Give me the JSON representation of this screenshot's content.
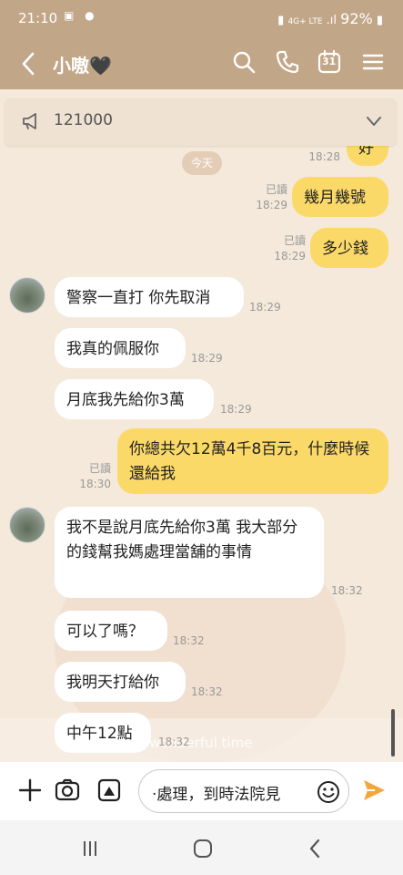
{
  "status_bar": {
    "time": "21:10",
    "network": "4G+ LTE",
    "battery": "92%"
  },
  "header": {
    "back_label": "<",
    "title": "小嗷🖤",
    "calendar_day": "31"
  },
  "announcement": {
    "text": "121000"
  },
  "date_separator": "今天",
  "messages": [
    {
      "id": "m0",
      "side": "out",
      "text": "好",
      "read": "",
      "time": "18:28"
    },
    {
      "id": "m1",
      "side": "out",
      "text": "幾月幾號",
      "read": "已讀",
      "time": "18:29"
    },
    {
      "id": "m2",
      "side": "out",
      "text": "多少錢",
      "read": "已讀",
      "time": "18:29"
    },
    {
      "id": "m3",
      "side": "in",
      "text": "警察一直打 你先取消",
      "time": "18:29"
    },
    {
      "id": "m4",
      "side": "in",
      "text": "我真的佩服你",
      "time": "18:29"
    },
    {
      "id": "m5",
      "side": "in",
      "text": "月底我先給你3萬",
      "time": "18:29"
    },
    {
      "id": "m6",
      "side": "out",
      "text": "你總共欠12萬4千8百元，什麼時候還給我",
      "read": "已讀",
      "time": "18:30"
    },
    {
      "id": "m7",
      "side": "in",
      "text": "我不是說月底先給你3萬 我大部分的錢幫我媽處理當舖的事情",
      "time": "18:32"
    },
    {
      "id": "m8",
      "side": "in",
      "text": "可以了嗎？",
      "time": "18:32"
    },
    {
      "id": "m9",
      "side": "in",
      "text": "我明天打給你",
      "time": "18:32"
    },
    {
      "id": "m10",
      "side": "in",
      "text": "中午12點",
      "time": "18:32"
    }
  ],
  "background_caption": "a wonderful time",
  "composer": {
    "value": "·處理，到時法院見"
  },
  "colors": {
    "header": "#c2a688",
    "outgoing_bubble": "#fbd968",
    "incoming_bubble": "#ffffff",
    "send_icon": "#f4a63a"
  }
}
